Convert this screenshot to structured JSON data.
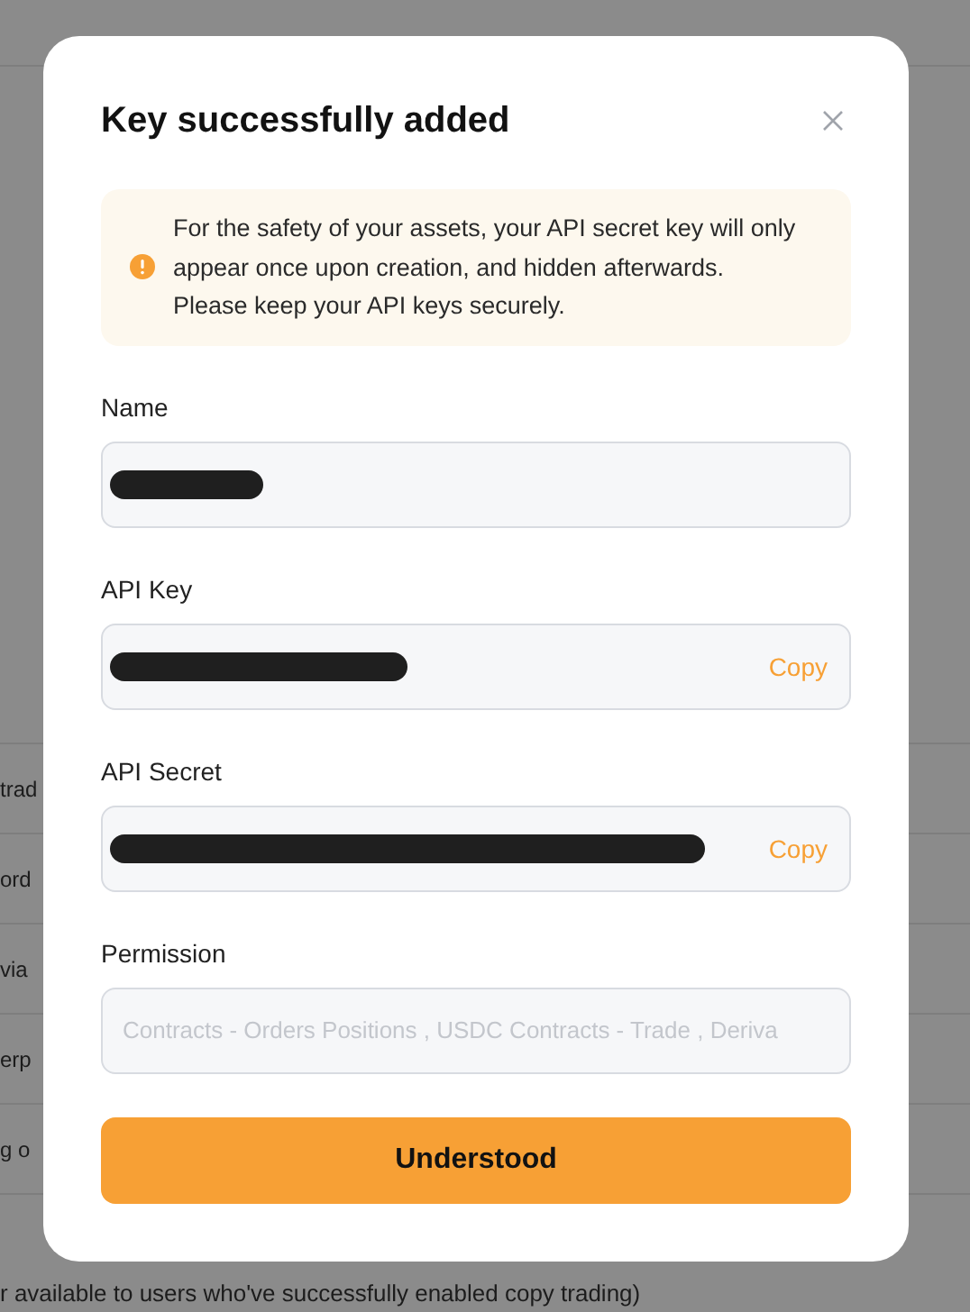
{
  "background": {
    "rows": [
      "trad",
      "ord",
      "via",
      "erp",
      "g o"
    ],
    "footnote": "r available to users who've successfully enabled copy trading)"
  },
  "dialog": {
    "title": "Key successfully added",
    "alert": {
      "lines": [
        "For the safety of your assets, your API secret key will only",
        "appear once upon creation, and hidden afterwards.",
        "Please keep your API keys securely."
      ]
    },
    "fields": [
      {
        "label": "Name",
        "kind": "redacted"
      },
      {
        "label": "API Key",
        "kind": "redacted",
        "action": "Copy"
      },
      {
        "label": "API Secret",
        "kind": "redacted",
        "action": "Copy"
      },
      {
        "label": "Permission",
        "kind": "text",
        "disabled": true,
        "value": "Contracts - Orders Positions  , USDC Contracts - Trade  , Deriva"
      }
    ],
    "button": "Understood"
  }
}
